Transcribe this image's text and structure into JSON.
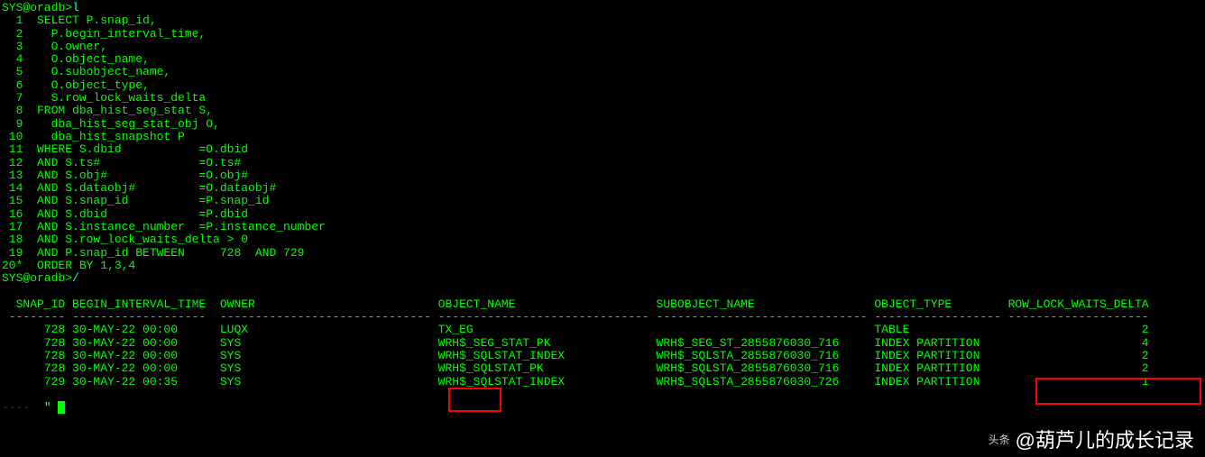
{
  "prompt1": "SYS@oradb>",
  "prompt1_cmd": "l",
  "prompt2": "SYS@oradb>",
  "prompt2_cmd": "/",
  "sql_lines": [
    {
      "n": "1",
      "text": "SELECT P.snap_id,"
    },
    {
      "n": "2",
      "text": "  P.begin_interval_time,"
    },
    {
      "n": "3",
      "text": "  O.owner,"
    },
    {
      "n": "4",
      "text": "  O.object_name,"
    },
    {
      "n": "5",
      "text": "  O.subobject_name,"
    },
    {
      "n": "6",
      "text": "  O.object_type,"
    },
    {
      "n": "7",
      "text": "  S.row_lock_waits_delta"
    },
    {
      "n": "8",
      "text": "FROM dba_hist_seg_stat S,"
    },
    {
      "n": "9",
      "text": "  dba_hist_seg_stat_obj O,"
    },
    {
      "n": "10",
      "text": "  dba_hist_snapshot P"
    },
    {
      "n": "11",
      "text": "WHERE S.dbid           =O.dbid"
    },
    {
      "n": "12",
      "text": "AND S.ts#              =O.ts#"
    },
    {
      "n": "13",
      "text": "AND S.obj#             =O.obj#"
    },
    {
      "n": "14",
      "text": "AND S.dataobj#         =O.dataobj#"
    },
    {
      "n": "15",
      "text": "AND S.snap_id          =P.snap_id"
    },
    {
      "n": "16",
      "text": "AND S.dbid             =P.dbid"
    },
    {
      "n": "17",
      "text": "AND S.instance_number  =P.instance_number"
    },
    {
      "n": "18",
      "text": "AND S.row_lock_waits_delta > 0"
    },
    {
      "n": "19",
      "text": "AND P.snap_id BETWEEN     728  AND 729"
    },
    {
      "n": "20*",
      "text": "ORDER BY 1,3,4"
    }
  ],
  "headers": {
    "snap_id": "SNAP_ID",
    "begin_interval": "BEGIN_INTERVAL_TIME",
    "owner": "OWNER",
    "object_name": "OBJECT_NAME",
    "subobject_name": "SUBOBJECT_NAME",
    "object_type": "OBJECT_TYPE",
    "row_lock_waits": "ROW_LOCK_WAITS_DELTA"
  },
  "dashes": {
    "c1": "--------",
    "c2": "-------------------",
    "c3": "------------------------------",
    "c4": "------------------------------",
    "c5": "------------------------------",
    "c6": "------------------",
    "c7": "--------------------"
  },
  "rows": [
    {
      "snap_id": "728",
      "time": "30-MAY-22 00:00",
      "owner": "LUQX",
      "obj": "TX_EG",
      "subobj": "",
      "type": "TABLE",
      "delta": "2"
    },
    {
      "snap_id": "728",
      "time": "30-MAY-22 00:00",
      "owner": "SYS",
      "obj": "WRH$_SEG_STAT_PK",
      "subobj": "WRH$_SEG_ST_2855876030_716",
      "type": "INDEX PARTITION",
      "delta": "4"
    },
    {
      "snap_id": "728",
      "time": "30-MAY-22 00:00",
      "owner": "SYS",
      "obj": "WRH$_SQLSTAT_INDEX",
      "subobj": "WRH$_SQLSTA_2855876030_716",
      "type": "INDEX PARTITION",
      "delta": "2"
    },
    {
      "snap_id": "728",
      "time": "30-MAY-22 00:00",
      "owner": "SYS",
      "obj": "WRH$_SQLSTAT_PK",
      "subobj": "WRH$_SQLSTA_2855876030_716",
      "type": "INDEX PARTITION",
      "delta": "2"
    },
    {
      "snap_id": "729",
      "time": "30-MAY-22 00:35",
      "owner": "SYS",
      "obj": "WRH$_SQLSTAT_INDEX",
      "subobj": "WRH$_SQLSTA_2855876030_726",
      "type": "INDEX PARTITION",
      "delta": "1"
    }
  ],
  "watermark_label": "头条",
  "watermark_text": "@葫芦儿的成长记录"
}
